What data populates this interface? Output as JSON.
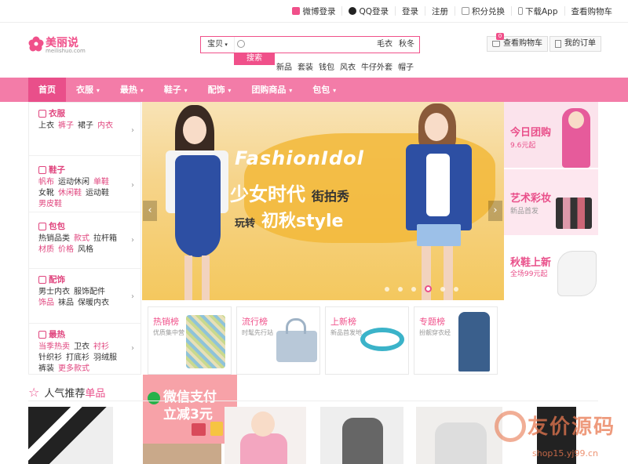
{
  "topbar": {
    "items": [
      {
        "label": "微博登录",
        "icon": "weibo-icon"
      },
      {
        "label": "QQ登录",
        "icon": "qq-icon"
      },
      {
        "label": "登录"
      },
      {
        "label": "注册"
      },
      {
        "label": "积分兑换",
        "icon": "points-icon"
      },
      {
        "label": "下载App",
        "icon": "phone-icon"
      },
      {
        "label": "查看购物车"
      }
    ]
  },
  "logo": {
    "name": "美丽说",
    "sub": "meilishuo.com"
  },
  "search": {
    "category": "宝贝",
    "placeholder": "",
    "hot_in_box": [
      "毛衣",
      "秋冬"
    ],
    "button": "搜索",
    "hot_words": [
      "新品",
      "套装",
      "钱包",
      "风衣",
      "牛仔外套",
      "帽子"
    ]
  },
  "header_buttons": {
    "cart": "查看购物车",
    "cart_count": "0",
    "orders": "我的订单"
  },
  "nav": {
    "items": [
      {
        "label": "首页",
        "active": true,
        "arrow": ""
      },
      {
        "label": "衣服",
        "arrow": "▾"
      },
      {
        "label": "最热",
        "arrow": "▾"
      },
      {
        "label": "鞋子",
        "arrow": "▾"
      },
      {
        "label": "配饰",
        "arrow": "▾"
      },
      {
        "label": "团购商品",
        "arrow": "▾"
      },
      {
        "label": "包包",
        "arrow": "▾"
      }
    ]
  },
  "sidebar": {
    "groups": [
      {
        "title": "衣服",
        "rows": [
          [
            "上衣",
            "裤子",
            "裙子",
            "内衣"
          ]
        ]
      },
      {
        "title": "鞋子",
        "rows": [
          [
            "帆布",
            "运动休闲",
            "单鞋"
          ],
          [
            "女靴",
            "休闲鞋",
            "运动鞋"
          ],
          [
            "男皮鞋"
          ]
        ]
      },
      {
        "title": "包包",
        "rows": [
          [
            "热销品类",
            "款式",
            "拉杆箱"
          ],
          [
            "材质",
            "价格",
            "风格"
          ]
        ]
      },
      {
        "title": "配饰",
        "rows": [
          [
            "男士内衣",
            "服饰配件"
          ],
          [
            "饰品",
            "袜品",
            "保暖内衣"
          ]
        ]
      },
      {
        "title": "最热",
        "rows": [
          [
            "当季热卖",
            "卫衣",
            "衬衫"
          ],
          [
            "针织衫",
            "打底衫",
            "羽绒服"
          ],
          [
            "裤装",
            "更多款式"
          ]
        ]
      }
    ]
  },
  "banner": {
    "line1": "FashionIdol",
    "line2": "少女时代",
    "line2_script": "街拍秀",
    "line3_script": "玩转",
    "line3": "初秋style",
    "prev": "‹",
    "next": "›",
    "slides": 6,
    "active_slide": 4
  },
  "promos": [
    {
      "title": "今日团购",
      "sub": "9.6元起",
      "title_color": "#e94f8a"
    },
    {
      "title": "艺术彩妆",
      "sub": "新品首发",
      "title_color": "#e94f8a"
    },
    {
      "title": "秋鞋上新",
      "sub": "全场99元起",
      "title_color": "#e94f8a"
    }
  ],
  "ranks": [
    {
      "title": "热销榜",
      "sub": "优质集中营"
    },
    {
      "title": "流行榜",
      "sub": "时髦先行站"
    },
    {
      "title": "上新榜",
      "sub": "新品首发地"
    },
    {
      "title": "专题榜",
      "sub": "扮靓穿衣经"
    }
  ],
  "wechat_ad": {
    "line1": "微信支付",
    "line2": "立减3元"
  },
  "popular": {
    "prefix": "人气推荐",
    "highlight": "单品"
  },
  "watermark": {
    "big": "友价源码",
    "url": "shop15.yj99.cn"
  },
  "colors": {
    "brand": "#f0508a",
    "nav": "#f37ca8",
    "nav_active": "#e94f8a"
  }
}
